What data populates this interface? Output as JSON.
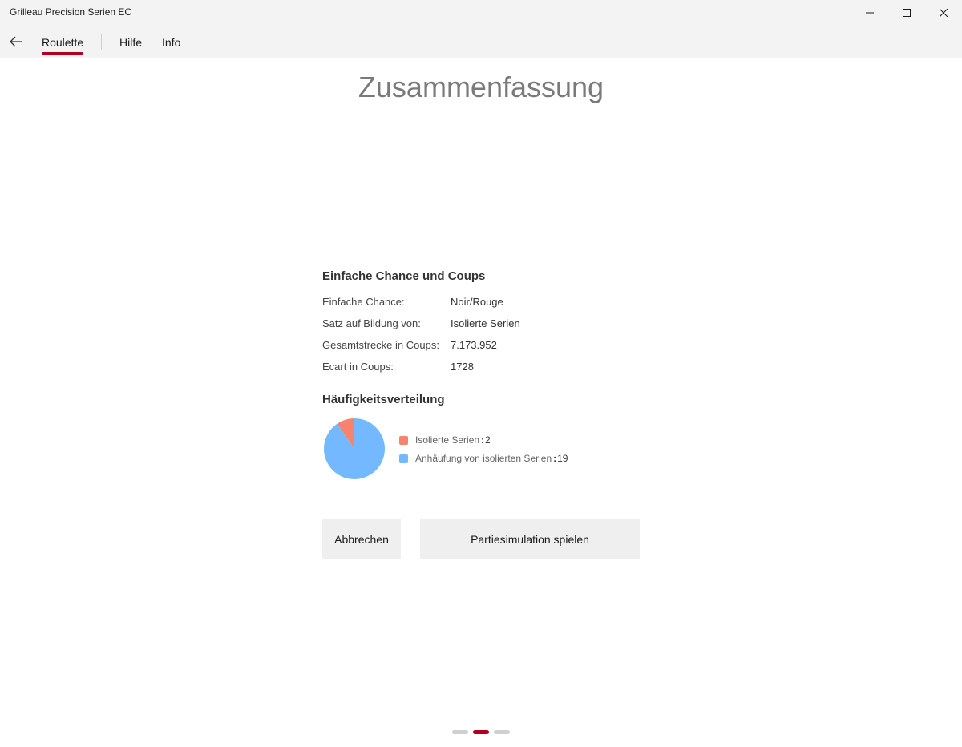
{
  "window": {
    "title": "Grilleau Precision Serien EC"
  },
  "nav": {
    "items": [
      {
        "label": "Roulette",
        "active": true
      },
      {
        "label": "Hilfe"
      },
      {
        "label": "Info"
      }
    ],
    "accent": "#b0001e"
  },
  "page": {
    "title": "Zusammenfassung"
  },
  "summary": {
    "heading": "Einfache Chance und Coups",
    "rows": [
      {
        "label": "Einfache Chance:",
        "value": "Noir/Rouge"
      },
      {
        "label": "Satz auf Bildung von:",
        "value": "Isolierte Serien"
      },
      {
        "label": "Gesamtstrecke in Coups:",
        "value": "7.173.952"
      },
      {
        "label": "Ecart in Coups:",
        "value": "1728"
      }
    ]
  },
  "distribution": {
    "heading": "Häufigkeitsverteilung"
  },
  "chart_data": {
    "type": "pie",
    "slices": [
      {
        "name": "Isolierte Serien",
        "value": 2,
        "color": "#f7836f"
      },
      {
        "name": "Anhäufung von isolierten Serien",
        "value": 19,
        "color": "#74b9ff"
      }
    ],
    "separator": ":",
    "legend_position": "right"
  },
  "actions": {
    "cancel_label": "Abbrechen",
    "play_label": "Partiesimulation spielen"
  },
  "pager": {
    "count": 3,
    "active_index": 1
  }
}
